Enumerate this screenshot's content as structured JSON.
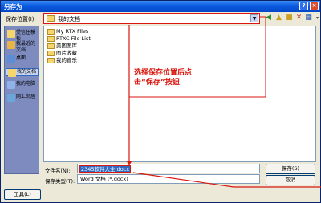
{
  "window": {
    "title": "另存为"
  },
  "toolbar": {
    "save_in_label": "保存位置(I):",
    "save_in_value": "我的文档",
    "icons": [
      "back-icon",
      "up-folder-icon",
      "new-folder-icon",
      "delete-icon",
      "views-icon",
      "tools-icon"
    ]
  },
  "places": [
    {
      "label": "我最近的文档",
      "icon": "recent-icon"
    },
    {
      "label": "桌面",
      "icon": "desktop-icon"
    },
    {
      "label": "我的文档",
      "icon": "my-documents-icon"
    },
    {
      "label": "我的电脑",
      "icon": "my-computer-icon"
    },
    {
      "label": "网上邻居",
      "icon": "network-icon"
    }
  ],
  "places_top": {
    "label": "受信任模板"
  },
  "files": [
    {
      "name": "My RTX Files"
    },
    {
      "name": "RTXC File List"
    },
    {
      "name": "美图图库"
    },
    {
      "name": "图片收藏"
    },
    {
      "name": "我的音乐"
    }
  ],
  "annotation": {
    "text": "选择保存位置后点击“保存”按钮"
  },
  "form": {
    "filename_label": "文件名(N):",
    "filename_value": "2345软件大全.docx",
    "filetype_label": "保存类型(T):",
    "filetype_value": "Word 文档 (*.docx)"
  },
  "buttons": {
    "tools": "工具(L)",
    "save": "保存(S)",
    "cancel": "取消"
  },
  "colors": {
    "annotation_red": "#d9170f",
    "titlebar_blue": "#0a5ae0"
  }
}
